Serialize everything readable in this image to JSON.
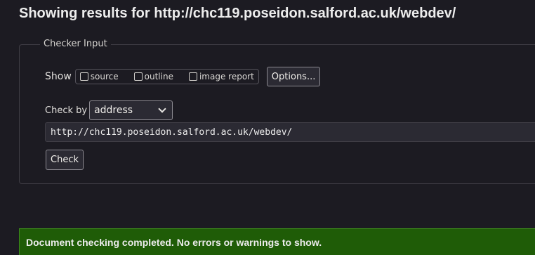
{
  "heading": "Showing results for http://chc119.poseidon.salford.ac.uk/webdev/",
  "checker": {
    "legend": "Checker Input",
    "show_label": "Show",
    "options": [
      {
        "label": "source",
        "checked": false
      },
      {
        "label": "outline",
        "checked": false
      },
      {
        "label": "image report",
        "checked": false
      }
    ],
    "options_button": "Options...",
    "check_by_label": "Check by",
    "check_by_value": "address",
    "url_value": "http://chc119.poseidon.salford.ac.uk/webdev/",
    "check_button": "Check"
  },
  "status": {
    "message": "Document checking completed. No errors or warnings to show.",
    "color": "#1f5c07"
  }
}
